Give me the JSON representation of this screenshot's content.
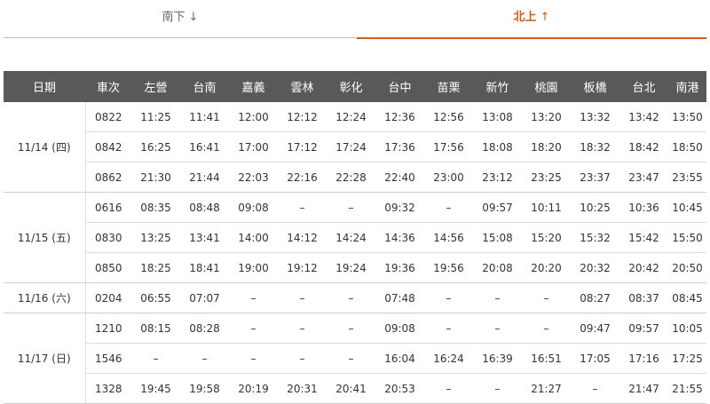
{
  "tabs": [
    {
      "label": "南下",
      "arrow": "↓",
      "active": false
    },
    {
      "label": "北上",
      "arrow": "↑",
      "active": true
    }
  ],
  "colors": {
    "accent": "#c95d1b",
    "header_bg": "#595959",
    "divider": "#dddddd"
  },
  "table": {
    "headers": [
      "日期",
      "車次",
      "左營",
      "台南",
      "嘉義",
      "雲林",
      "彰化",
      "台中",
      "苗栗",
      "新竹",
      "桃園",
      "板橋",
      "台北",
      "南港"
    ],
    "groups": [
      {
        "date": "11/14 (四)",
        "trains": [
          [
            "0822",
            "11:25",
            "11:41",
            "12:00",
            "12:12",
            "12:24",
            "12:36",
            "12:56",
            "13:08",
            "13:20",
            "13:32",
            "13:42",
            "13:50"
          ],
          [
            "0842",
            "16:25",
            "16:41",
            "17:00",
            "17:12",
            "17:24",
            "17:36",
            "17:56",
            "18:08",
            "18:20",
            "18:32",
            "18:42",
            "18:50"
          ],
          [
            "0862",
            "21:30",
            "21:44",
            "22:03",
            "22:16",
            "22:28",
            "22:40",
            "23:00",
            "23:12",
            "23:25",
            "23:37",
            "23:47",
            "23:55"
          ]
        ]
      },
      {
        "date": "11/15 (五)",
        "trains": [
          [
            "0616",
            "08:35",
            "08:48",
            "09:08",
            "–",
            "–",
            "09:32",
            "–",
            "09:57",
            "10:11",
            "10:25",
            "10:36",
            "10:45"
          ],
          [
            "0830",
            "13:25",
            "13:41",
            "14:00",
            "14:12",
            "14:24",
            "14:36",
            "14:56",
            "15:08",
            "15:20",
            "15:32",
            "15:42",
            "15:50"
          ],
          [
            "0850",
            "18:25",
            "18:41",
            "19:00",
            "19:12",
            "19:24",
            "19:36",
            "19:56",
            "20:08",
            "20:20",
            "20:32",
            "20:42",
            "20:50"
          ]
        ]
      },
      {
        "date": "11/16 (六)",
        "trains": [
          [
            "0204",
            "06:55",
            "07:07",
            "–",
            "–",
            "–",
            "07:48",
            "–",
            "–",
            "–",
            "08:27",
            "08:37",
            "08:45"
          ]
        ]
      },
      {
        "date": "11/17 (日)",
        "trains": [
          [
            "1210",
            "08:15",
            "08:28",
            "–",
            "–",
            "–",
            "09:08",
            "–",
            "–",
            "–",
            "09:47",
            "09:57",
            "10:05"
          ],
          [
            "1546",
            "–",
            "–",
            "–",
            "–",
            "–",
            "16:04",
            "16:24",
            "16:39",
            "16:51",
            "17:05",
            "17:16",
            "17:25"
          ],
          [
            "1328",
            "19:45",
            "19:58",
            "20:19",
            "20:31",
            "20:41",
            "20:53",
            "–",
            "–",
            "21:27",
            "–",
            "21:47",
            "21:55"
          ]
        ]
      }
    ]
  }
}
